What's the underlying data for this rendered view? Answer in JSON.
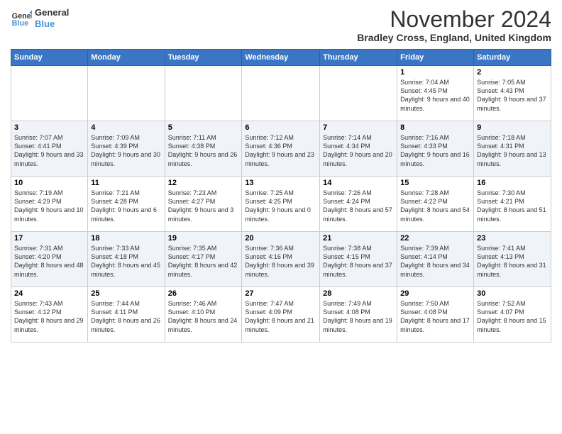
{
  "logo": {
    "line1": "General",
    "line2": "Blue"
  },
  "title": "November 2024",
  "subtitle": "Bradley Cross, England, United Kingdom",
  "days_header": [
    "Sunday",
    "Monday",
    "Tuesday",
    "Wednesday",
    "Thursday",
    "Friday",
    "Saturday"
  ],
  "weeks": [
    [
      {
        "day": "",
        "info": ""
      },
      {
        "day": "",
        "info": ""
      },
      {
        "day": "",
        "info": ""
      },
      {
        "day": "",
        "info": ""
      },
      {
        "day": "",
        "info": ""
      },
      {
        "day": "1",
        "info": "Sunrise: 7:04 AM\nSunset: 4:45 PM\nDaylight: 9 hours and 40 minutes."
      },
      {
        "day": "2",
        "info": "Sunrise: 7:05 AM\nSunset: 4:43 PM\nDaylight: 9 hours and 37 minutes."
      }
    ],
    [
      {
        "day": "3",
        "info": "Sunrise: 7:07 AM\nSunset: 4:41 PM\nDaylight: 9 hours and 33 minutes."
      },
      {
        "day": "4",
        "info": "Sunrise: 7:09 AM\nSunset: 4:39 PM\nDaylight: 9 hours and 30 minutes."
      },
      {
        "day": "5",
        "info": "Sunrise: 7:11 AM\nSunset: 4:38 PM\nDaylight: 9 hours and 26 minutes."
      },
      {
        "day": "6",
        "info": "Sunrise: 7:12 AM\nSunset: 4:36 PM\nDaylight: 9 hours and 23 minutes."
      },
      {
        "day": "7",
        "info": "Sunrise: 7:14 AM\nSunset: 4:34 PM\nDaylight: 9 hours and 20 minutes."
      },
      {
        "day": "8",
        "info": "Sunrise: 7:16 AM\nSunset: 4:33 PM\nDaylight: 9 hours and 16 minutes."
      },
      {
        "day": "9",
        "info": "Sunrise: 7:18 AM\nSunset: 4:31 PM\nDaylight: 9 hours and 13 minutes."
      }
    ],
    [
      {
        "day": "10",
        "info": "Sunrise: 7:19 AM\nSunset: 4:29 PM\nDaylight: 9 hours and 10 minutes."
      },
      {
        "day": "11",
        "info": "Sunrise: 7:21 AM\nSunset: 4:28 PM\nDaylight: 9 hours and 6 minutes."
      },
      {
        "day": "12",
        "info": "Sunrise: 7:23 AM\nSunset: 4:27 PM\nDaylight: 9 hours and 3 minutes."
      },
      {
        "day": "13",
        "info": "Sunrise: 7:25 AM\nSunset: 4:25 PM\nDaylight: 9 hours and 0 minutes."
      },
      {
        "day": "14",
        "info": "Sunrise: 7:26 AM\nSunset: 4:24 PM\nDaylight: 8 hours and 57 minutes."
      },
      {
        "day": "15",
        "info": "Sunrise: 7:28 AM\nSunset: 4:22 PM\nDaylight: 8 hours and 54 minutes."
      },
      {
        "day": "16",
        "info": "Sunrise: 7:30 AM\nSunset: 4:21 PM\nDaylight: 8 hours and 51 minutes."
      }
    ],
    [
      {
        "day": "17",
        "info": "Sunrise: 7:31 AM\nSunset: 4:20 PM\nDaylight: 8 hours and 48 minutes."
      },
      {
        "day": "18",
        "info": "Sunrise: 7:33 AM\nSunset: 4:18 PM\nDaylight: 8 hours and 45 minutes."
      },
      {
        "day": "19",
        "info": "Sunrise: 7:35 AM\nSunset: 4:17 PM\nDaylight: 8 hours and 42 minutes."
      },
      {
        "day": "20",
        "info": "Sunrise: 7:36 AM\nSunset: 4:16 PM\nDaylight: 8 hours and 39 minutes."
      },
      {
        "day": "21",
        "info": "Sunrise: 7:38 AM\nSunset: 4:15 PM\nDaylight: 8 hours and 37 minutes."
      },
      {
        "day": "22",
        "info": "Sunrise: 7:39 AM\nSunset: 4:14 PM\nDaylight: 8 hours and 34 minutes."
      },
      {
        "day": "23",
        "info": "Sunrise: 7:41 AM\nSunset: 4:13 PM\nDaylight: 8 hours and 31 minutes."
      }
    ],
    [
      {
        "day": "24",
        "info": "Sunrise: 7:43 AM\nSunset: 4:12 PM\nDaylight: 8 hours and 29 minutes."
      },
      {
        "day": "25",
        "info": "Sunrise: 7:44 AM\nSunset: 4:11 PM\nDaylight: 8 hours and 26 minutes."
      },
      {
        "day": "26",
        "info": "Sunrise: 7:46 AM\nSunset: 4:10 PM\nDaylight: 8 hours and 24 minutes."
      },
      {
        "day": "27",
        "info": "Sunrise: 7:47 AM\nSunset: 4:09 PM\nDaylight: 8 hours and 21 minutes."
      },
      {
        "day": "28",
        "info": "Sunrise: 7:49 AM\nSunset: 4:08 PM\nDaylight: 8 hours and 19 minutes."
      },
      {
        "day": "29",
        "info": "Sunrise: 7:50 AM\nSunset: 4:08 PM\nDaylight: 8 hours and 17 minutes."
      },
      {
        "day": "30",
        "info": "Sunrise: 7:52 AM\nSunset: 4:07 PM\nDaylight: 8 hours and 15 minutes."
      }
    ]
  ]
}
